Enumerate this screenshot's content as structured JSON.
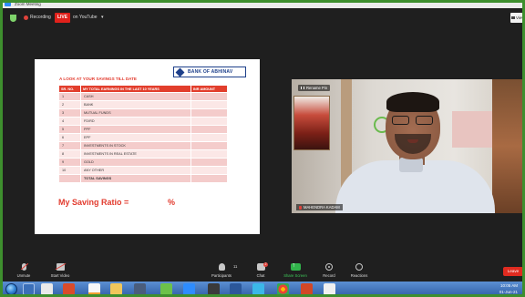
{
  "window": {
    "title": "Zoom Meeting"
  },
  "topbar": {
    "recording_label": "Recording",
    "live_badge": "LIVE",
    "live_on_label": "on YouTube",
    "live_chevron": "▾",
    "view_button": "View"
  },
  "slide": {
    "logo_text": "BANK OF ABHINAV",
    "title": "A LOOK AT YOUR SAVINGS TILL DATE",
    "table": {
      "headers": [
        "SR. NO.",
        "MY TOTAL EARNINGS IN THE LAST 10 YEARS",
        "INR AMOUNT"
      ],
      "rows": [
        {
          "sn": "1",
          "item": "CASH",
          "amount": ""
        },
        {
          "sn": "2",
          "item": "BANK",
          "amount": ""
        },
        {
          "sn": "3",
          "item": "MUTUAL FUNDS",
          "amount": ""
        },
        {
          "sn": "4",
          "item": "FD/RD",
          "amount": ""
        },
        {
          "sn": "5",
          "item": "PPF",
          "amount": ""
        },
        {
          "sn": "6",
          "item": "EPF",
          "amount": ""
        },
        {
          "sn": "7",
          "item": "INVESTMENTS IN STOCK",
          "amount": ""
        },
        {
          "sn": "8",
          "item": "INVESTMENTS IN REAL ESTATE",
          "amount": ""
        },
        {
          "sn": "9",
          "item": "GOLD",
          "amount": ""
        },
        {
          "sn": "10",
          "item": "ANY OTHER",
          "amount": ""
        },
        {
          "sn": "",
          "item": "TOTAL SAVINGS",
          "amount": ""
        }
      ]
    },
    "ratio_label": "My Saving Ratio =",
    "ratio_suffix": "%"
  },
  "video": {
    "rename_badge": "Rename Pin",
    "participant_name": "MAHENDRA KADAM"
  },
  "toolbar": {
    "unmute": "Unmute",
    "start_video": "Start Video",
    "participants_count": "11",
    "participants": "Participants",
    "chat": "Chat",
    "chat_badge": "2",
    "share_screen": "Share Screen",
    "record": "Record",
    "reactions": "Reactions",
    "leave": "Leave"
  },
  "taskbar": {
    "time": "10:05 AM",
    "date": "01-Jun-21"
  },
  "colors": {
    "slide_red": "#e23e2c",
    "frame_green": "#3e8f2e",
    "share_green": "#31b44b",
    "leave_red": "#e02b20"
  }
}
